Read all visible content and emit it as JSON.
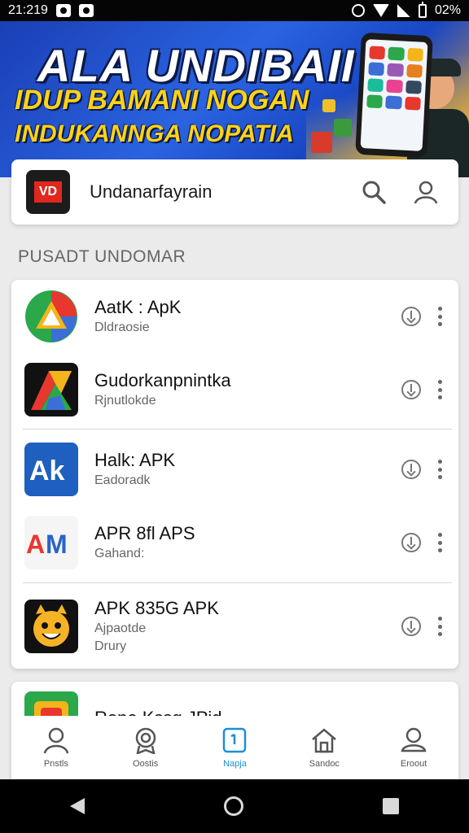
{
  "status_bar": {
    "time": "21:219",
    "battery": "02%"
  },
  "banner": {
    "title": "ALA UNDIBAII",
    "line1": "IDUP BAMANI NOGAN",
    "line2": "INDUKANNGA NOPATIA"
  },
  "search": {
    "logo_text": "VD",
    "title": "Undanarfayrain",
    "search_icon": "search-icon",
    "profile_icon": "person-icon"
  },
  "section": {
    "label": "PUSADT UNDOMAR"
  },
  "apps": [
    {
      "name": "AatK : ApK",
      "sub": "Dldraosie",
      "icon": "triangle-logo",
      "colors": [
        "#2aa84a",
        "#e8372e",
        "#f4b51a",
        "#3b6fd6"
      ]
    },
    {
      "name": "Gudorkanpnintka",
      "sub": "Rjnutlokde",
      "icon": "cube-logo",
      "colors": [
        "#111",
        "#e8372e",
        "#2aa84a",
        "#f4b51a"
      ]
    },
    {
      "name": "Halk: APK",
      "sub": "Eadoradk",
      "icon": "ak-logo",
      "colors": [
        "#1e5fbf",
        "#fff"
      ]
    },
    {
      "name": "APR 8fl APS",
      "sub": "Gahand:",
      "icon": "am-logo",
      "colors": [
        "#e8372e",
        "#2a63c8",
        "#f5f5f5"
      ]
    },
    {
      "name": "APK 835G APK",
      "sub": "Ajpaotde",
      "sub2": "Drury",
      "icon": "emoji-logo",
      "colors": [
        "#111",
        "#f5b325"
      ]
    }
  ],
  "partial_app": {
    "name": "Rone Kssg JPid",
    "icon": "tile-logo"
  },
  "bottom_nav": [
    {
      "label": "Pnstls",
      "icon": "person-icon"
    },
    {
      "label": "Oostis",
      "icon": "badge-icon"
    },
    {
      "label": "Napja",
      "icon": "tablet-icon",
      "active": true
    },
    {
      "label": "Sandoc",
      "icon": "home-icon"
    },
    {
      "label": "Eroout",
      "icon": "profile-icon"
    }
  ]
}
